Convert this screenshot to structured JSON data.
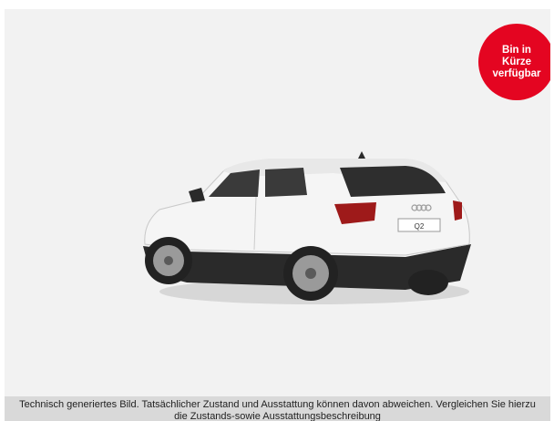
{
  "badge": {
    "text": "Bin in\nKürze\nverfügbar",
    "color": "#e40521"
  },
  "car": {
    "plate_text": "Q2",
    "paint_color": "#f5f5f5"
  },
  "disclaimer": {
    "line1": "Technisch generiertes Bild. Tatsächlicher Zustand und Ausstattung können davon abweichen. Vergleichen Sie hierzu",
    "line2": "die Zustands-sowie Ausstattungsbeschreibung"
  }
}
